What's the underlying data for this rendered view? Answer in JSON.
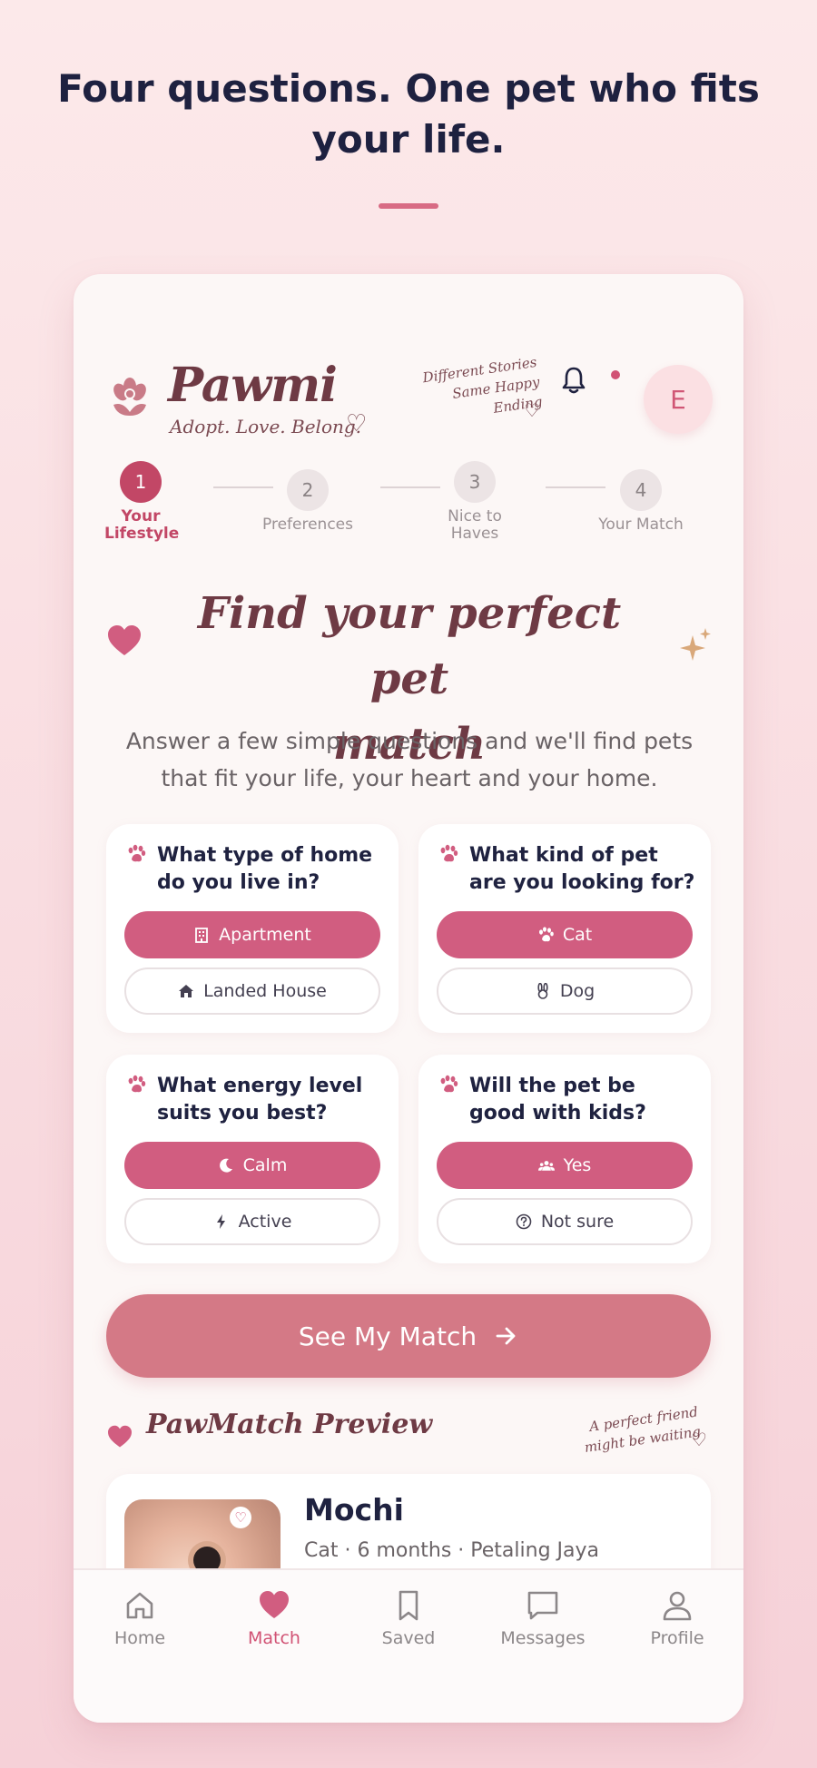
{
  "headline": {
    "line1": "Four questions. One pet who fits",
    "line2": "your life."
  },
  "brand": {
    "name": "Pawmi",
    "tagline": "Adopt. Love. Belong.",
    "note_line1": "Different Stories",
    "note_line2": "Same Happy Ending"
  },
  "avatar_initial": "E",
  "steps": [
    {
      "number": "1",
      "label": "Your Lifestyle",
      "active": true
    },
    {
      "number": "2",
      "label": "Preferences",
      "active": false
    },
    {
      "number": "3",
      "label": "Nice to Haves",
      "active": false
    },
    {
      "number": "4",
      "label": "Your Match",
      "active": false
    }
  ],
  "hero": {
    "title_line1": "Find your perfect pet",
    "title_line2": "match",
    "subtitle_line1": "Answer a few simple questions and we'll find pets",
    "subtitle_line2": "that fit your life, your heart and your home."
  },
  "questions": [
    {
      "title": "What type of home do you live in?",
      "options": [
        {
          "label": "Apartment",
          "icon": "building-icon",
          "selected": true
        },
        {
          "label": "Landed House",
          "icon": "house-icon",
          "selected": false
        }
      ]
    },
    {
      "title": "What kind of pet are you looking for?",
      "options": [
        {
          "label": "Cat",
          "icon": "paw-icon",
          "selected": true
        },
        {
          "label": "Dog",
          "icon": "bunny-icon",
          "selected": false
        }
      ]
    },
    {
      "title": "What energy level suits you best?",
      "options": [
        {
          "label": "Calm",
          "icon": "moon-icon",
          "selected": true
        },
        {
          "label": "Active",
          "icon": "bolt-icon",
          "selected": false
        }
      ]
    },
    {
      "title": "Will the pet be good with kids?",
      "options": [
        {
          "label": "Yes",
          "icon": "people-icon",
          "selected": true
        },
        {
          "label": "Not sure",
          "icon": "question-icon",
          "selected": false
        }
      ]
    }
  ],
  "cta_label": "See My Match",
  "pawmatch": {
    "title": "PawMatch Preview",
    "note_line1": "A perfect friend",
    "note_line2": "might be waiting",
    "pet": {
      "name": "Mochi",
      "meta": "Cat · 6 months · Petaling Jaya"
    }
  },
  "nav": [
    {
      "label": "Home",
      "icon": "home-icon",
      "active": false
    },
    {
      "label": "Match",
      "icon": "heart-icon",
      "active": true
    },
    {
      "label": "Saved",
      "icon": "bookmark-icon",
      "active": false
    },
    {
      "label": "Messages",
      "icon": "message-icon",
      "active": false
    },
    {
      "label": "Profile",
      "icon": "profile-icon",
      "active": false
    }
  ],
  "colors": {
    "accent": "#d15d80",
    "brand": "#6e3a44",
    "cta": "#d47986",
    "active_step": "#c24766"
  }
}
